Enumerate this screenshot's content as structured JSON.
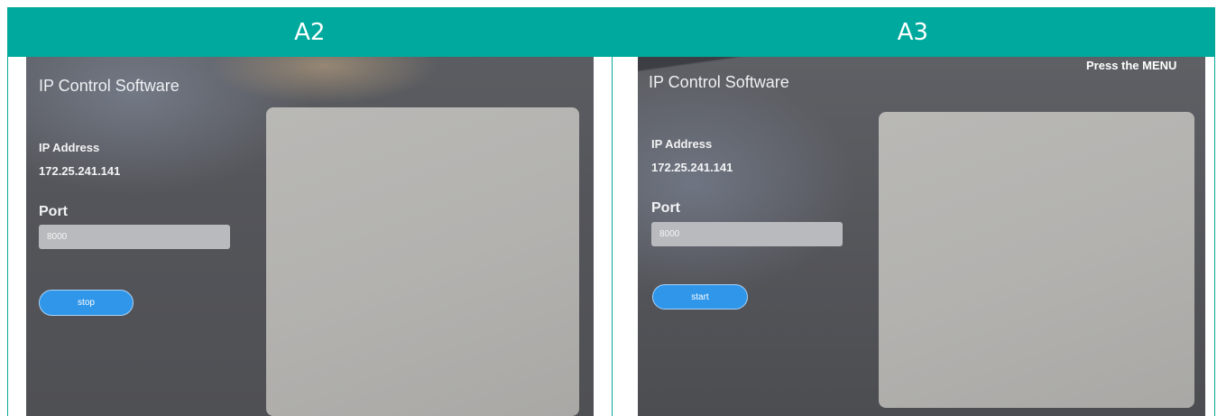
{
  "headers": {
    "left": "A2",
    "right": "A3"
  },
  "panels": {
    "a2": {
      "title": "IP Control Software",
      "ip_label": "IP Address",
      "ip_value": "172.25.241.141",
      "port_label": "Port",
      "port_value": "8000",
      "button_label": "stop"
    },
    "a3": {
      "title": "IP Control Software",
      "top_right_text": "Press the MENU",
      "ip_label": "IP Address",
      "ip_value": "172.25.241.141",
      "port_label": "Port",
      "port_value": "8000",
      "button_label": "start"
    }
  },
  "colors": {
    "header_bg": "#00a99d",
    "button_bg": "#2f96ea"
  }
}
